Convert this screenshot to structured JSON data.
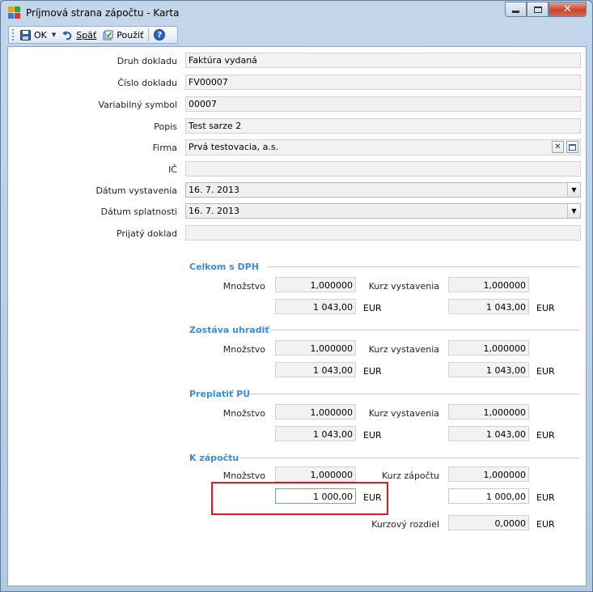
{
  "window": {
    "title": "Príjmová strana zápočtu - Karta",
    "close_symbol": "✕",
    "accent": "#3e8ad8",
    "highlight_color": "#e3162b"
  },
  "toolbar": {
    "ok_label": "OK",
    "back_label": "Späť",
    "apply_label": "Použiť"
  },
  "form": {
    "druh_dokladu": {
      "label": "Druh dokladu",
      "value": "Faktúra vydaná"
    },
    "cislo_dokladu": {
      "label": "Číslo dokladu",
      "value": "FV00007"
    },
    "variabilny_symbol": {
      "label": "Variabilný symbol",
      "value": "00007"
    },
    "popis": {
      "label": "Popis",
      "value": "Test sarze 2"
    },
    "firma": {
      "label": "Firma",
      "value": "Prvá testovacia, a.s."
    },
    "ic": {
      "label": "IČ",
      "value": ""
    },
    "datum_vystavenia": {
      "label": "Dátum vystavenia",
      "value": "16. 7. 2013"
    },
    "datum_splatnosti": {
      "label": "Dátum splatnosti",
      "value": "16. 7. 2013"
    },
    "prijaty_doklad": {
      "label": "Prijatý doklad",
      "value": ""
    }
  },
  "groups": {
    "celkom": {
      "title": "Celkom s DPH",
      "mnozstvo_label": "Množstvo",
      "mnozstvo": "1,000000",
      "kurz_label": "Kurz vystavenia",
      "kurz": "1,000000",
      "amount1": "1 043,00",
      "currency1": "EUR",
      "amount2": "1 043,00",
      "currency2": "EUR"
    },
    "zostava": {
      "title": "Zostáva uhradiť",
      "mnozstvo_label": "Množstvo",
      "mnozstvo": "1,000000",
      "kurz_label": "Kurz vystavenia",
      "kurz": "1,000000",
      "amount1": "1 043,00",
      "currency1": "EUR",
      "amount2": "1 043,00",
      "currency2": "EUR"
    },
    "preplatit": {
      "title": "Preplatiť PÚ",
      "mnozstvo_label": "Množstvo",
      "mnozstvo": "1,000000",
      "kurz_label": "Kurz vystavenia",
      "kurz": "1,000000",
      "amount1": "1 043,00",
      "currency1": "EUR",
      "amount2": "1 043,00",
      "currency2": "EUR"
    },
    "k_zapoctu": {
      "title": "K zápočtu",
      "mnozstvo_label": "Množstvo",
      "mnozstvo": "1,000000",
      "kurz_label": "Kurz zápočtu",
      "kurz": "1,000000",
      "amount1": "1 000,00",
      "currency1": "EUR",
      "amount2": "1 000,00",
      "currency2": "EUR",
      "kurzovy_rozdiel_label": "Kurzový rozdiel",
      "kurzovy_rozdiel": "0,0000",
      "currency3": "EUR"
    }
  }
}
